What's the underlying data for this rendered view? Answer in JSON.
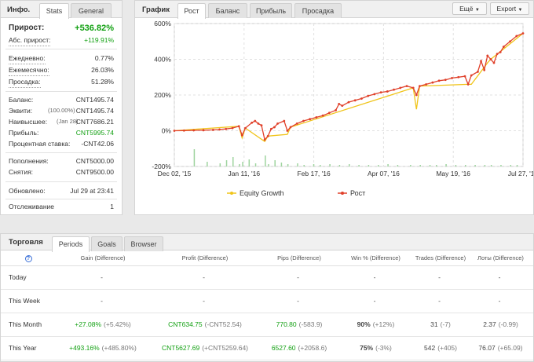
{
  "info": {
    "title": "Инфо.",
    "tabs": [
      "Stats",
      "General"
    ],
    "gain_label": "Прирост:",
    "gain_value": "+536.82%",
    "abs_gain_label": "Абс. прирост:",
    "abs_gain_value": "+119.91%",
    "daily_label": "Ежедневно:",
    "daily_value": "0.77%",
    "monthly_label": "Ежемесячно:",
    "monthly_value": "26.03%",
    "drawdown_label": "Просадка:",
    "drawdown_value": "51.28%",
    "balance_label": "Баланс:",
    "balance_value": "CNT1495.74",
    "equity_label": "Эквити:",
    "equity_pct": "(100.00%)",
    "equity_value": "CNT1495.74",
    "highest_label": "Наивысшее:",
    "highest_date": "(Jan 28)",
    "highest_value": "CNT7686.21",
    "profit_label": "Прибыль:",
    "profit_value": "CNT5995.74",
    "interest_label": "Процентная ставка:",
    "interest_value": "-CNT42.06",
    "deposits_label": "Пополнения:",
    "deposits_value": "CNT5000.00",
    "withdrawals_label": "Снятия:",
    "withdrawals_value": "CNT9500.00",
    "updated_label": "Обновлено:",
    "updated_value": "Jul 29 at 23:41",
    "tracking_label": "Отслеживание",
    "tracking_value": "1"
  },
  "chart_panel": {
    "title": "График",
    "tabs": [
      "Рост",
      "Баланс",
      "Прибыль",
      "Просадка"
    ],
    "more_button": "Ещё",
    "export_button": "Export"
  },
  "chart_data": {
    "type": "line",
    "ylim": [
      -200,
      600
    ],
    "yticks": [
      "600%",
      "400%",
      "200%",
      "0%",
      "-200%"
    ],
    "xticks": [
      "Dec 02, '15",
      "Jan 11, '16",
      "Feb 17, '16",
      "Apr 07, '16",
      "May 19, '16",
      "Jul 27, '16"
    ],
    "legend": [
      "Equity Growth",
      "Рост"
    ],
    "colors": {
      "equity": "#f0c419",
      "growth": "#e0402a",
      "volume": "#9fd49f"
    },
    "series": [
      {
        "name": "Рост",
        "points": [
          [
            0,
            0
          ],
          [
            3,
            1
          ],
          [
            6,
            2
          ],
          [
            9,
            3
          ],
          [
            12,
            5
          ],
          [
            14,
            7
          ],
          [
            16,
            10
          ],
          [
            18,
            15
          ],
          [
            20,
            25
          ],
          [
            21,
            -25
          ],
          [
            22,
            15
          ],
          [
            24,
            45
          ],
          [
            25,
            55
          ],
          [
            26,
            40
          ],
          [
            27,
            30
          ],
          [
            28,
            -50
          ],
          [
            29,
            -30
          ],
          [
            30,
            10
          ],
          [
            31,
            20
          ],
          [
            32,
            40
          ],
          [
            34,
            55
          ],
          [
            35,
            0
          ],
          [
            36,
            20
          ],
          [
            38,
            40
          ],
          [
            40,
            55
          ],
          [
            42,
            65
          ],
          [
            44,
            75
          ],
          [
            46,
            85
          ],
          [
            48,
            100
          ],
          [
            50,
            115
          ],
          [
            51,
            150
          ],
          [
            52,
            140
          ],
          [
            54,
            160
          ],
          [
            56,
            170
          ],
          [
            58,
            180
          ],
          [
            60,
            195
          ],
          [
            62,
            205
          ],
          [
            64,
            215
          ],
          [
            66,
            220
          ],
          [
            68,
            230
          ],
          [
            70,
            240
          ],
          [
            72,
            250
          ],
          [
            74,
            240
          ],
          [
            75,
            200
          ],
          [
            76,
            250
          ],
          [
            78,
            260
          ],
          [
            80,
            270
          ],
          [
            82,
            280
          ],
          [
            84,
            285
          ],
          [
            86,
            295
          ],
          [
            88,
            300
          ],
          [
            90,
            305
          ],
          [
            91,
            260
          ],
          [
            92,
            310
          ],
          [
            94,
            330
          ],
          [
            95,
            390
          ],
          [
            96,
            340
          ],
          [
            97,
            420
          ],
          [
            98,
            400
          ],
          [
            99,
            380
          ],
          [
            100,
            430
          ],
          [
            101,
            440
          ],
          [
            102,
            470
          ],
          [
            104,
            500
          ],
          [
            106,
            530
          ],
          [
            108,
            545
          ]
        ]
      },
      {
        "name": "Equity Growth",
        "points": [
          [
            0,
            0
          ],
          [
            20,
            25
          ],
          [
            21,
            -40
          ],
          [
            22,
            15
          ],
          [
            28,
            -60
          ],
          [
            29,
            -30
          ],
          [
            35,
            -20
          ],
          [
            36,
            20
          ],
          [
            74,
            240
          ],
          [
            75,
            120
          ],
          [
            76,
            250
          ],
          [
            91,
            260
          ],
          [
            92,
            260
          ],
          [
            97,
            380
          ],
          [
            98,
            400
          ],
          [
            108,
            545
          ]
        ]
      }
    ]
  },
  "trading": {
    "title": "Торговля",
    "tabs": [
      "Periods",
      "Goals",
      "Browser"
    ],
    "info_icon": "info-icon",
    "headers": [
      "Gain (Difference)",
      "Profit (Difference)",
      "Pips (Difference)",
      "Win % (Difference)",
      "Trades (Difference)",
      "Лоты (Difference)"
    ],
    "rows": [
      {
        "label": "Today",
        "cells": [
          [
            "-",
            ""
          ],
          [
            "-",
            ""
          ],
          [
            "-",
            ""
          ],
          [
            "-",
            ""
          ],
          [
            "-",
            ""
          ],
          [
            "-",
            ""
          ]
        ]
      },
      {
        "label": "This Week",
        "cells": [
          [
            "-",
            ""
          ],
          [
            "-",
            ""
          ],
          [
            "-",
            ""
          ],
          [
            "-",
            ""
          ],
          [
            "-",
            ""
          ],
          [
            "-",
            ""
          ]
        ]
      },
      {
        "label": "This Month",
        "cells": [
          [
            "+27.08%",
            "(+5.42%)"
          ],
          [
            "CNT634.75",
            "(-CNT52.54)"
          ],
          [
            "770.80",
            "(-583.9)"
          ],
          [
            "90%",
            "(+12%)"
          ],
          [
            "31",
            "(-7)"
          ],
          [
            "2.37",
            "(-0.99)"
          ]
        ]
      },
      {
        "label": "This Year",
        "cells": [
          [
            "+493.16%",
            "(+485.80%)"
          ],
          [
            "CNT5627.69",
            "(+CNT5259.64)"
          ],
          [
            "6527.60",
            "(+2058.6)"
          ],
          [
            "75%",
            "(-3%)"
          ],
          [
            "542",
            "(+405)"
          ],
          [
            "76.07",
            "(+65.09)"
          ]
        ]
      }
    ]
  }
}
